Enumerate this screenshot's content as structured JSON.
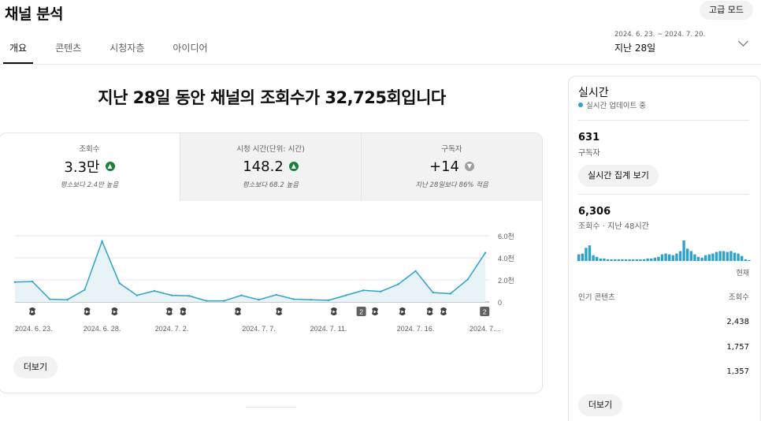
{
  "header": {
    "title": "채널 분석",
    "advanced_mode_label": "고급 모드"
  },
  "tabs": [
    {
      "label": "개요",
      "active": true
    },
    {
      "label": "콘텐츠",
      "active": false
    },
    {
      "label": "시청자층",
      "active": false
    },
    {
      "label": "아이디어",
      "active": false
    }
  ],
  "date_range": {
    "range": "2024. 6. 23. ~ 2024. 7. 20.",
    "label": "지난 28일"
  },
  "headline": "지난 28일 동안 채널의 조회수가 32,725회입니다",
  "metrics": [
    {
      "label": "조회수",
      "value": "3.3만",
      "trend": "up",
      "note": "평소보다 2.4만 높음"
    },
    {
      "label": "시청 시간(단위: 시간)",
      "value": "148.2",
      "trend": "up",
      "note": "평소보다 68.2 높음"
    },
    {
      "label": "구독자",
      "value": "+14",
      "trend": "down",
      "note": "지난 28일보다 86% 적음"
    }
  ],
  "chart_data": {
    "type": "area",
    "series": [
      {
        "values": [
          1.8,
          1.85,
          0.25,
          0.2,
          1.1,
          5.5,
          1.7,
          0.6,
          1.0,
          0.6,
          0.55,
          0.1,
          0.1,
          0.6,
          0.2,
          0.65,
          0.25,
          0.2,
          0.15,
          0.6,
          1.05,
          0.95,
          1.6,
          2.8,
          0.85,
          0.75,
          2.05,
          4.45
        ]
      }
    ],
    "x_tick_labels": [
      "2024. 6. 23.",
      "2024. 6. 28.",
      "2024. 7. 2.",
      "2024. 7. 7.",
      "2024. 7. 11.",
      "2024. 7. 16.",
      "2024. 7...."
    ],
    "x_tick_index": [
      0,
      5,
      9,
      14,
      18,
      23,
      27
    ],
    "y_tick_labels": [
      "6.0천",
      "4.0천",
      "2.0천",
      "0"
    ],
    "y_ticks": [
      6,
      4,
      2,
      0
    ],
    "ylim": [
      0,
      6.5
    ],
    "grid": true,
    "line_color": "#2ea2cc",
    "fill_color": "#e8f3f8",
    "markers": [
      {
        "day": 1,
        "type": "short"
      },
      {
        "day": 5,
        "type": "short"
      },
      {
        "day": 7,
        "type": "short"
      },
      {
        "day": 11,
        "type": "short"
      },
      {
        "day": 12,
        "type": "short"
      },
      {
        "day": 16,
        "type": "short"
      },
      {
        "day": 19,
        "type": "short"
      },
      {
        "day": 23,
        "type": "short"
      },
      {
        "day": 25,
        "type": "count",
        "label": "2"
      },
      {
        "day": 26,
        "type": "short"
      },
      {
        "day": 28,
        "type": "short"
      },
      {
        "day": 30,
        "type": "short"
      },
      {
        "day": 31,
        "type": "short"
      },
      {
        "day": 34,
        "type": "count",
        "label": "2"
      }
    ]
  },
  "more_label": "더보기",
  "realtime": {
    "title": "실시간",
    "live_text": "실시간 업데이트 중",
    "subscribers_value": "631",
    "subscribers_label": "구독자",
    "realtime_button": "실시간 집계 보기",
    "views_value": "6,306",
    "views_label": "조회수 · 지난 48시간",
    "hourly_views": [
      8,
      9,
      16,
      19,
      7,
      5,
      3,
      3,
      2,
      2,
      2,
      2,
      2,
      2,
      2,
      2,
      2,
      2,
      2,
      3,
      3,
      4,
      5,
      8,
      9,
      8,
      7,
      9,
      12,
      25,
      15,
      12,
      8,
      5,
      4,
      7,
      8,
      9,
      11,
      12,
      12,
      11,
      12,
      10,
      9,
      6,
      2,
      1
    ],
    "now_label": "현재",
    "popular_label": "인기 콘텐츠",
    "popular_col": "조회수",
    "popular_values": [
      "2,438",
      "1,757",
      "1,357"
    ],
    "more_label": "더보기"
  }
}
